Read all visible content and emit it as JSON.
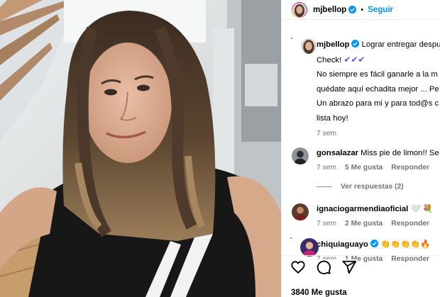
{
  "header": {
    "username": "mjbellop",
    "dot": "•",
    "follow_label": "Seguir"
  },
  "caption": {
    "username": "mjbellop",
    "line1": "Lograr entregar despu",
    "line2_prefix": "Check! ",
    "checks": "✔✔✔",
    "line3": "No siempre es fácil ganarle a la m",
    "line4": "quédate aquí echadita mejor ... Pe",
    "line5": "Un abrazo para mi y para tod@s c",
    "line6": "lista hoy!",
    "time": "7 sem"
  },
  "comments": [
    {
      "username": "gonsalazar",
      "text": "Miss pie de limon!! Se",
      "time": "7 sem",
      "likes": "5 Me gusta",
      "reply": "Responder",
      "view_replies": "Ver respuestas (2)"
    },
    {
      "username": "ignaciogarmendiaoficial",
      "text": "🤍 💐",
      "time": "7 sem",
      "likes": "2 Me gusta",
      "reply": "Responder"
    },
    {
      "username": "chiquiaguayo",
      "text": "👏👏👏👏🔥",
      "time": "7 sem",
      "likes": "1 Me gusta",
      "reply": "Responder"
    }
  ],
  "likes_count": "3840 Me gusta",
  "colors": {
    "accent": "#0095f6",
    "verified": "#0095f6",
    "secondary_text": "#737373"
  },
  "icons": {
    "like": "heart-icon",
    "comment": "comment-icon",
    "share": "share-icon"
  }
}
